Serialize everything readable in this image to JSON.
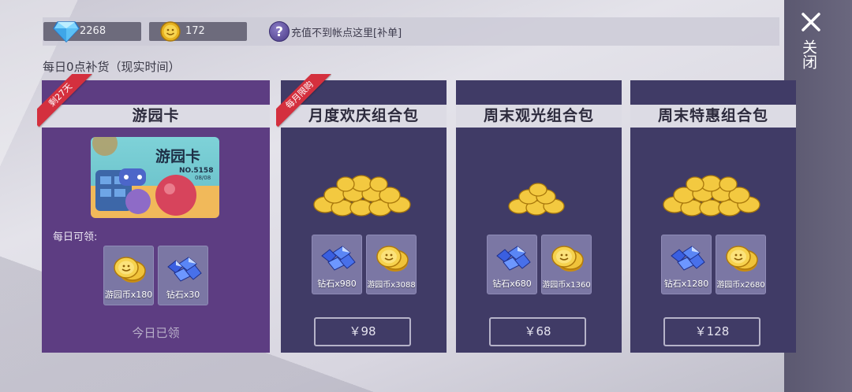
{
  "currencies": {
    "diamond": {
      "icon": "diamond-icon",
      "value": "2268"
    },
    "coin": {
      "icon": "coin-icon",
      "value": "172"
    }
  },
  "help_text": "充值不到帐点这里[补单]",
  "close_label": "关闭",
  "restock_text": "每日0点补货（现实时间）",
  "park_card": {
    "ribbon": "剩27天",
    "title": "游园卡",
    "art_title": "游园卡",
    "art_no": "NO.5158",
    "art_date": "08/08",
    "daily_label": "每日可领:",
    "items": [
      {
        "icon": "coin-icon",
        "label": "游园币x180"
      },
      {
        "icon": "diamond-icon",
        "label": "钻石x30"
      }
    ],
    "claimed_text": "今日已领"
  },
  "bundles": [
    {
      "ribbon": "每月限购",
      "title": "月度欢庆组合包",
      "items": [
        {
          "icon": "diamond-icon",
          "label": "钻石x980"
        },
        {
          "icon": "coin-icon",
          "label": "游园币x3088"
        }
      ],
      "price": "￥98"
    },
    {
      "ribbon": "",
      "title": "周末观光组合包",
      "items": [
        {
          "icon": "diamond-icon",
          "label": "钻石x680"
        },
        {
          "icon": "coin-icon",
          "label": "游园币x1360"
        }
      ],
      "price": "￥68"
    },
    {
      "ribbon": "",
      "title": "周末特惠组合包",
      "items": [
        {
          "icon": "diamond-icon",
          "label": "钻石x1280"
        },
        {
          "icon": "coin-icon",
          "label": "游园币x2680"
        }
      ],
      "price": "￥128"
    }
  ],
  "colors": {
    "park_card_bg": "#5d3d82",
    "bundle_bg": "#403b66",
    "ribbon_red": "#d4303e",
    "close_panel_bg": "#5b5870"
  }
}
